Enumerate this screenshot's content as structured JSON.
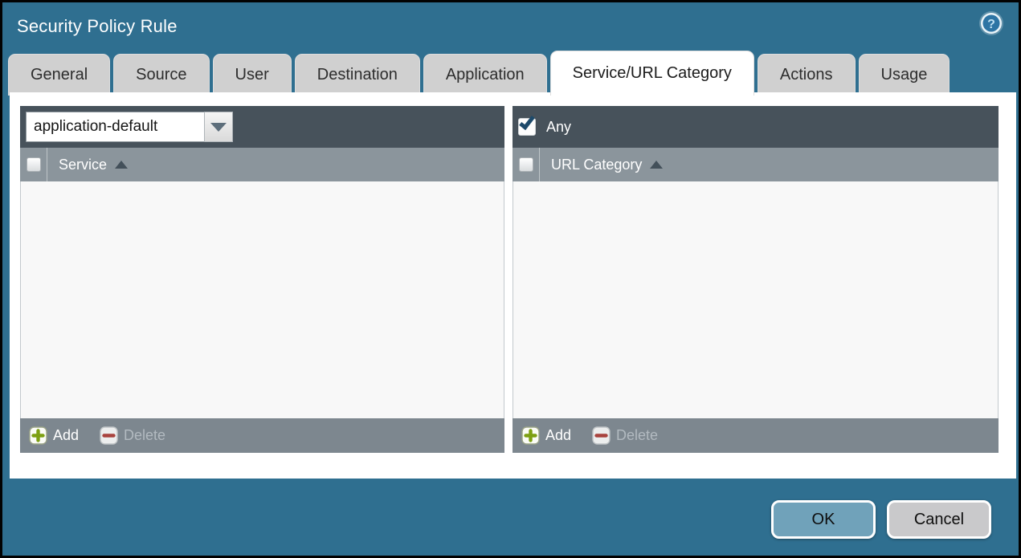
{
  "window": {
    "title": "Security Policy Rule"
  },
  "tabs": [
    {
      "label": "General",
      "active": false
    },
    {
      "label": "Source",
      "active": false
    },
    {
      "label": "User",
      "active": false
    },
    {
      "label": "Destination",
      "active": false
    },
    {
      "label": "Application",
      "active": false
    },
    {
      "label": "Service/URL Category",
      "active": true
    },
    {
      "label": "Actions",
      "active": false
    },
    {
      "label": "Usage",
      "active": false
    }
  ],
  "service_panel": {
    "dropdown_value": "application-default",
    "column_header": "Service",
    "rows": [],
    "add_label": "Add",
    "delete_label": "Delete",
    "delete_enabled": false
  },
  "url_category_panel": {
    "any_label": "Any",
    "any_checked": true,
    "column_header": "URL Category",
    "rows": [],
    "add_label": "Add",
    "delete_label": "Delete",
    "delete_enabled": false
  },
  "dialog_buttons": {
    "ok": "OK",
    "cancel": "Cancel"
  },
  "icons": {
    "help": "help-icon",
    "dropdown_arrow": "chevron-down-icon",
    "sort_asc": "sort-ascending-icon",
    "add": "plus-icon",
    "delete": "minus-icon"
  },
  "colors": {
    "background_teal": "#2f6f90",
    "panel_toolbar": "#47525b",
    "header_row": "#8b959c",
    "footer_bar": "#7d878f",
    "tab_inactive": "#d0d0d0",
    "tab_active": "#ffffff",
    "ok_button": "#70a2ba",
    "cancel_button": "#c9c9cb",
    "add_green": "#7da012",
    "delete_red": "#a8433e",
    "checkmark_blue": "#1d4a6b"
  }
}
